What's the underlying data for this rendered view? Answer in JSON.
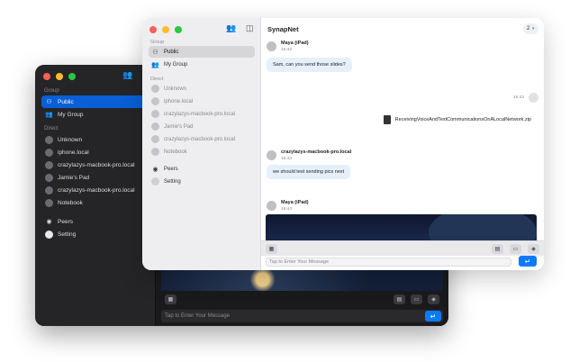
{
  "dark_window": {
    "sidebar": {
      "group_heading": "Group",
      "direct_heading": "Direct",
      "group_items": [
        {
          "label": "Public",
          "icon": "people-group-icon",
          "selected": true
        },
        {
          "label": "My Group",
          "icon": "people-icon",
          "selected": false
        }
      ],
      "direct_items": [
        {
          "label": "Unknown"
        },
        {
          "label": "iphone.local"
        },
        {
          "label": "crazylazys-macbook-pro.local"
        },
        {
          "label": "Jamie's Pad"
        },
        {
          "label": "crazylazys-macbook-pro.local"
        },
        {
          "label": "Notebook"
        }
      ],
      "footer_items": [
        {
          "label": "Peers",
          "icon": "peers-icon"
        },
        {
          "label": "Setting",
          "icon": "setting-icon"
        }
      ]
    },
    "input_placeholder": "Tap to Enter Your Message"
  },
  "light_window": {
    "title": "SynapNet",
    "badge_count": "2",
    "sidebar": {
      "group_heading": "Group",
      "direct_heading": "Direct",
      "group_items": [
        {
          "label": "Public",
          "icon": "people-group-icon",
          "selected": true
        },
        {
          "label": "My Group",
          "icon": "people-icon",
          "selected": false
        }
      ],
      "direct_items": [
        {
          "label": "Unknown"
        },
        {
          "label": "iphone.local"
        },
        {
          "label": "crazylazys-macbook-pro.local"
        },
        {
          "label": "Jamie's Pad"
        },
        {
          "label": "crazylazys-macbook-pro.local"
        },
        {
          "label": "Notebook"
        }
      ],
      "footer_items": [
        {
          "label": "Peers",
          "icon": "peers-icon"
        },
        {
          "label": "Setting",
          "icon": "setting-icon"
        }
      ]
    },
    "messages": [
      {
        "sender": "Maya (iPad)",
        "time": "16:43",
        "text": "Sam, can you send those slides?"
      },
      {
        "sender": "",
        "time": "16:43",
        "text": "ReceivingVoiceAndTextCommunicationsOnALocalNetwork.zip"
      },
      {
        "sender": "crazylazys-macbook-pro.local",
        "time": "16:43",
        "text": "we should test sending pics next"
      },
      {
        "sender": "Maya (iPad)",
        "time": "16:44",
        "text": ""
      }
    ],
    "input_placeholder": "Tap to Enter Your Message"
  },
  "colors": {
    "accent": "#0a7aff",
    "selected_dark": "#0a5fd6",
    "bubble": "#e6f0fb"
  }
}
